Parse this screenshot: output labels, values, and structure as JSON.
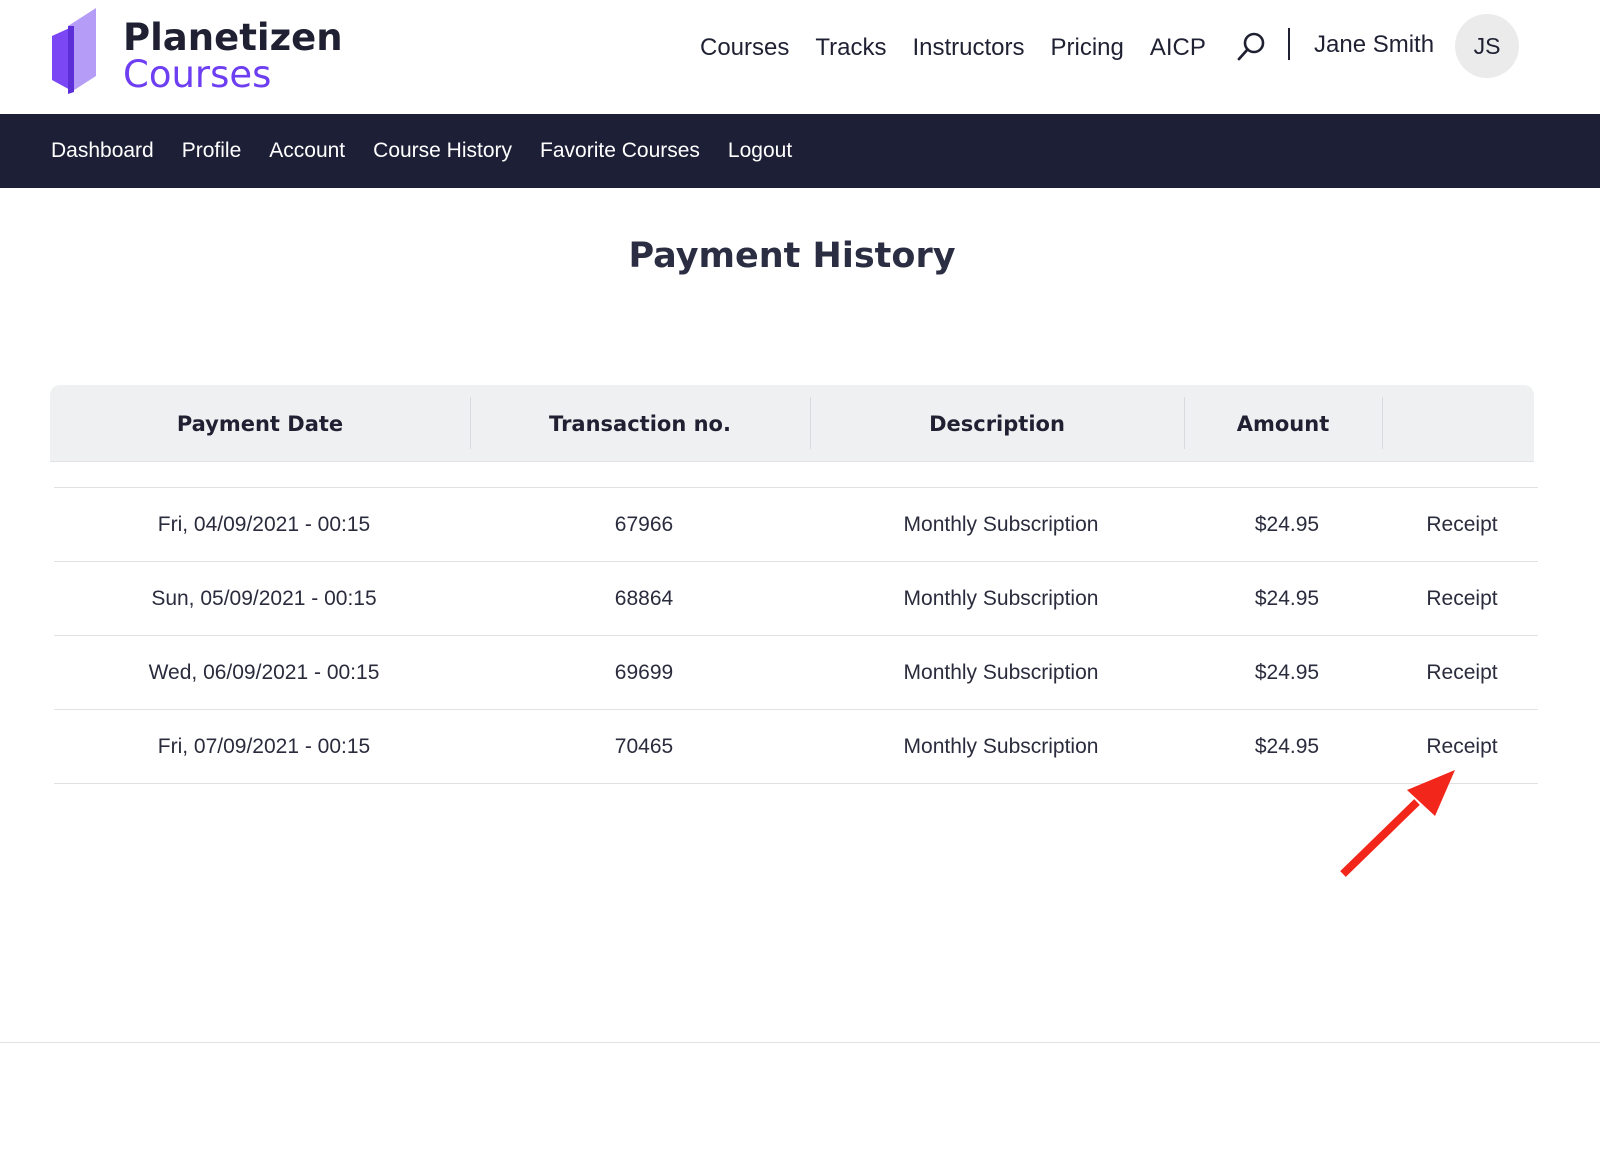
{
  "brand": {
    "line1": "Planetizen",
    "line2": "Courses"
  },
  "top_nav": [
    "Courses",
    "Tracks",
    "Instructors",
    "Pricing",
    "AICP"
  ],
  "user": {
    "name": "Jane Smith",
    "initials": "JS"
  },
  "sub_nav": [
    "Dashboard",
    "Profile",
    "Account",
    "Course History",
    "Favorite Courses",
    "Logout"
  ],
  "page_title": "Payment History",
  "table": {
    "headers": [
      "Payment Date",
      "Transaction no.",
      "Description",
      "Amount",
      ""
    ],
    "rows": [
      {
        "date": "Fri, 04/09/2021 - 00:15",
        "txn": "67966",
        "description": "Monthly Subscription",
        "amount": "$24.95",
        "action": "Receipt"
      },
      {
        "date": "Sun, 05/09/2021 - 00:15",
        "txn": "68864",
        "description": "Monthly Subscription",
        "amount": "$24.95",
        "action": "Receipt"
      },
      {
        "date": "Wed, 06/09/2021 - 00:15",
        "txn": "69699",
        "description": "Monthly Subscription",
        "amount": "$24.95",
        "action": "Receipt"
      },
      {
        "date": "Fri, 07/09/2021 - 00:15",
        "txn": "70465",
        "description": "Monthly Subscription",
        "amount": "$24.95",
        "action": "Receipt"
      }
    ]
  },
  "colors": {
    "brand_purple": "#6d3ef2",
    "nav_dark": "#1c1f35",
    "annotation_arrow": "#f2261a"
  },
  "icons": [
    "logo-mark-icon",
    "search-icon",
    "annotation-arrow-icon"
  ]
}
